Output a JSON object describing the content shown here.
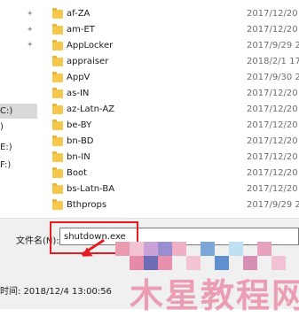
{
  "nav_pane": {
    "drives": [
      "C:)",
      ")",
      "E:)",
      "F:)"
    ],
    "selected_index": 0
  },
  "files": [
    {
      "name": "af-ZA",
      "date": "2017/12/20"
    },
    {
      "name": "am-ET",
      "date": "2017/12/20"
    },
    {
      "name": "AppLocker",
      "date": "2017/9/29 2"
    },
    {
      "name": "appraiser",
      "date": "2018/2/1 17"
    },
    {
      "name": "AppV",
      "date": "2017/9/30 2"
    },
    {
      "name": "as-IN",
      "date": "2017/12/20"
    },
    {
      "name": "az-Latn-AZ",
      "date": "2017/12/20"
    },
    {
      "name": "be-BY",
      "date": "2017/12/20"
    },
    {
      "name": "bn-BD",
      "date": "2017/12/20"
    },
    {
      "name": "bn-IN",
      "date": "2017/12/20"
    },
    {
      "name": "Boot",
      "date": "2017/12/20"
    },
    {
      "name": "bs-Latn-BA",
      "date": "2017/12/20"
    },
    {
      "name": "Bthprops",
      "date": "2017/9/29 2"
    }
  ],
  "filename": {
    "label": "文件名(N):",
    "value": "shutdown.exe"
  },
  "details": {
    "modified": "时间: 2018/12/4 13:00:56"
  },
  "colors": {
    "highlight": "#e51c23",
    "folder": "#f5c84b"
  }
}
